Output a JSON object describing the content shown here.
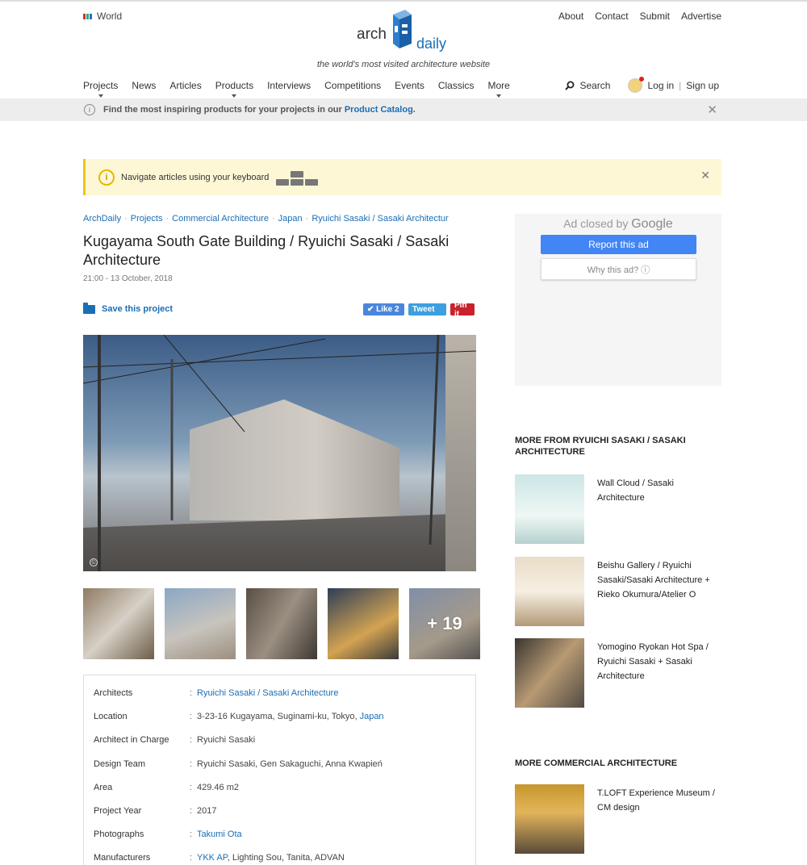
{
  "header": {
    "region": "World",
    "top_links": [
      "About",
      "Contact",
      "Submit",
      "Advertise"
    ],
    "logo_left": "arch",
    "logo_right": "daily",
    "tagline": "the world's most visited architecture website",
    "nav": [
      {
        "label": "Projects",
        "dropdown": true
      },
      {
        "label": "News",
        "dropdown": false
      },
      {
        "label": "Articles",
        "dropdown": false
      },
      {
        "label": "Products",
        "dropdown": true
      },
      {
        "label": "Interviews",
        "dropdown": false
      },
      {
        "label": "Competitions",
        "dropdown": false
      },
      {
        "label": "Events",
        "dropdown": false
      },
      {
        "label": "Classics",
        "dropdown": false
      },
      {
        "label": "More",
        "dropdown": true
      }
    ],
    "search": "Search",
    "login": "Log in",
    "signup": "Sign up",
    "separator": "|"
  },
  "infobar": {
    "text": "Find the most inspiring products for your projects in our ",
    "link": "Product Catalog",
    "suffix": "."
  },
  "keyboard": {
    "text": "Navigate articles using your keyboard"
  },
  "article": {
    "breadcrumb": [
      "ArchDaily",
      "Projects",
      "Commercial Architecture",
      "Japan",
      "Ryuichi Sasaki / Sasaki Architectur"
    ],
    "title": "Kugayama South Gate Building / Ryuichi Sasaki / Sasaki Architecture",
    "date": "21:00 - 13 October, 2018",
    "save": "Save this project",
    "like": "✔ Like 2",
    "tweet": "Tweet",
    "pin": "Pin it",
    "more_photos": "+ 19",
    "specs": [
      {
        "label": "Architects",
        "value": "Ryuichi Sasaki / Sasaki Architecture",
        "link": true
      },
      {
        "label": "Location",
        "value": "3-23-16 Kugayama, Suginami-ku, Tokyo, ",
        "link_tail": "Japan"
      },
      {
        "label": "Architect in Charge",
        "value": "Ryuichi Sasaki"
      },
      {
        "label": "Design Team",
        "value": "Ryuichi Sasaki, Gen Sakaguchi, Anna Kwapień"
      },
      {
        "label": "Area",
        "value": "429.46 m2"
      },
      {
        "label": "Project Year",
        "value": "2017"
      },
      {
        "label": "Photographs",
        "value": "Takumi Ota",
        "link": true
      },
      {
        "label": "Manufacturers",
        "value_link": "YKK AP",
        "value": ", Lighting Sou, Tanita, ADVAN"
      }
    ]
  },
  "ad": {
    "closed_prefix": "Ad closed by",
    "closed_brand": "Google",
    "report": "Report this ad",
    "why": "Why this ad? ⓘ"
  },
  "sidebar": {
    "more_from_title": "MORE FROM RYUICHI SASAKI / SASAKI ARCHITECTURE",
    "more_from": [
      "Wall Cloud / Sasaki Architecture",
      "Beishu Gallery / Ryuichi Sasaki/Sasaki Architecture + Rieko Okumura/Atelier O",
      "Yomogino Ryokan Hot Spa / Ryuichi Sasaki + Sasaki Architecture"
    ],
    "more_commercial_title": "MORE COMMERCIAL ARCHITECTURE",
    "more_commercial": [
      "T.LOFT Experience Museum / CM design"
    ]
  },
  "colors": {
    "link": "#1a6eb5",
    "google_blue": "#4285f4",
    "keyboard_bg": "#fdf7d6",
    "pinterest": "#c8232c"
  }
}
